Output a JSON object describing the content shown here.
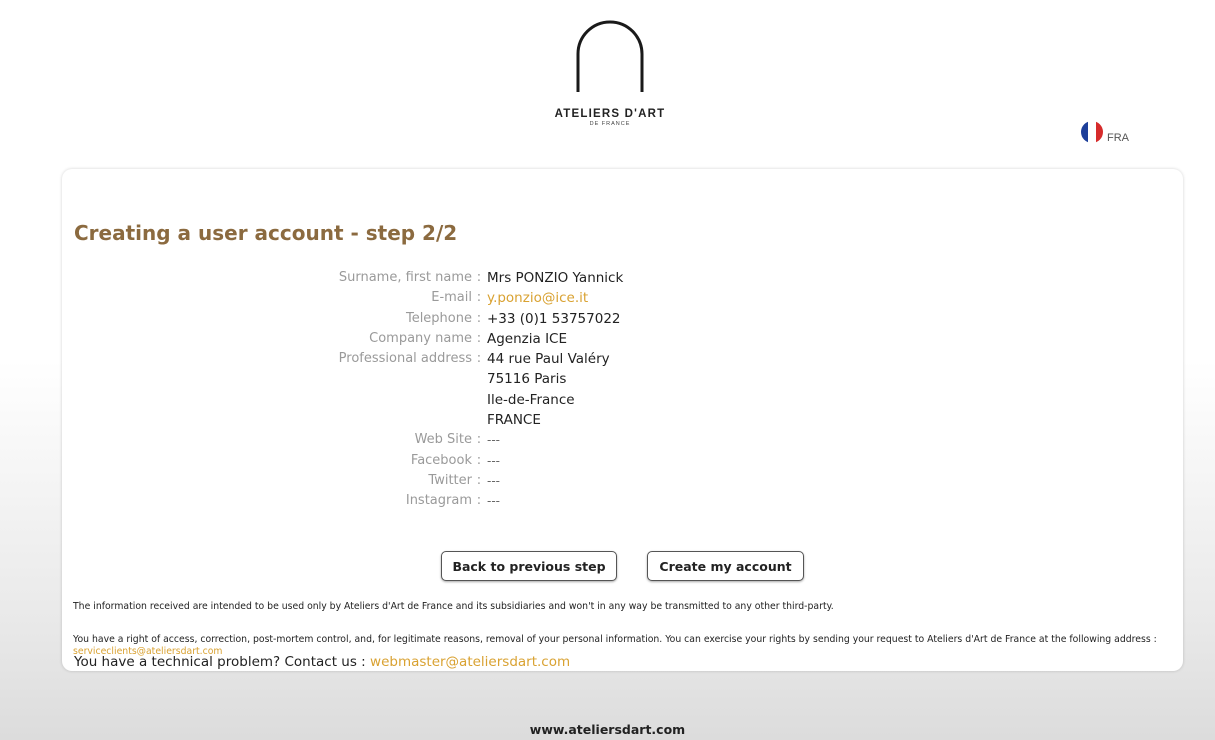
{
  "brand": {
    "name": "ATELIERS D'ART",
    "subtitle": "DE FRANCE"
  },
  "language": {
    "code": "FRA",
    "flag_icon": "france-flag-icon"
  },
  "page": {
    "title": "Creating a user account - step 2/2"
  },
  "fields": [
    {
      "label": "Surname, first name",
      "value": "Mrs PONZIO Yannick"
    },
    {
      "label": "E-mail",
      "value": "y.ponzio@ice.it"
    },
    {
      "label": "Telephone",
      "value": "+33 (0)1 53757022"
    },
    {
      "label": "Company name",
      "value": "Agenzia ICE"
    },
    {
      "label": "Professional address",
      "value": "44 rue Paul Valéry"
    },
    {
      "label": "",
      "value": "75116 Paris"
    },
    {
      "label": "",
      "value": "Ile-de-France"
    },
    {
      "label": "",
      "value": "FRANCE"
    },
    {
      "label": "Web Site",
      "value": "---"
    },
    {
      "label": "Facebook",
      "value": "---"
    },
    {
      "label": "Twitter",
      "value": "---"
    },
    {
      "label": "Instagram",
      "value": "---"
    }
  ],
  "separator": ":",
  "buttons": {
    "back": "Back to previous step",
    "create": "Create my account"
  },
  "notes": {
    "privacy": "The information received are intended to be used only by Ateliers d'Art de France and its subsidiaries and won't in any way be transmitted to any other third-party.",
    "rights": "You have a right of access, correction, post-mortem control, and, for legitimate reasons, removal of your personal information.  You can exercise your rights by sending your request to Ateliers d'Art de France at the following address :",
    "rights_email": "serviceclients@ateliersdart.com",
    "tech_text": "You have a technical problem? Contact us :",
    "tech_email": "webmaster@ateliersdart.com"
  },
  "footer": {
    "url": "www.ateliersdart.com"
  },
  "colors": {
    "title": "#8b6a3f",
    "link": "#d9a232",
    "label": "#9a9a9a"
  }
}
